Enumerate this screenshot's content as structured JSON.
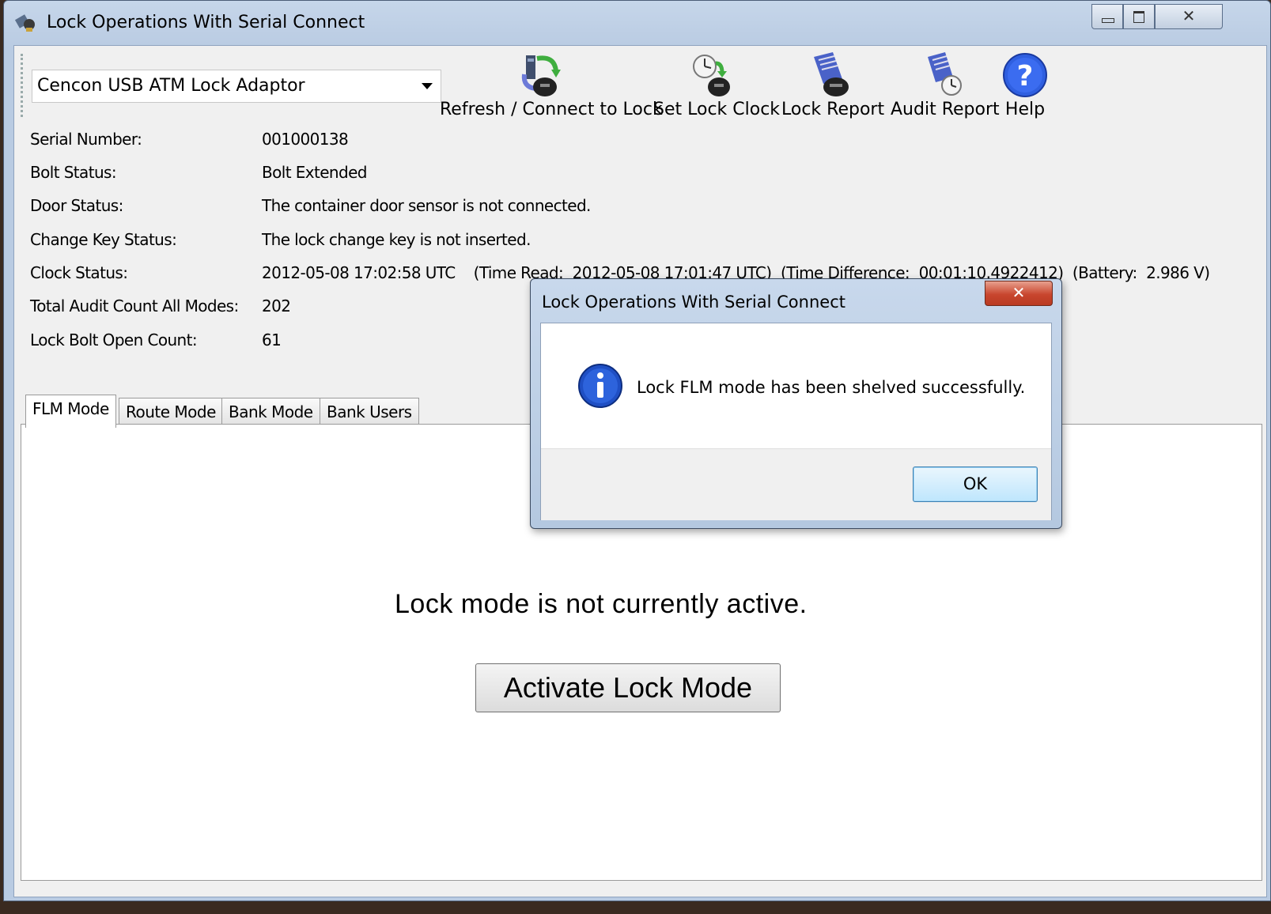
{
  "window": {
    "title": "Lock Operations With Serial Connect",
    "icon": "lock-app-icon"
  },
  "toolbar": {
    "device_select_value": "Cencon USB ATM Lock Adaptor",
    "buttons": [
      {
        "label": "Refresh / Connect to Lock",
        "icon": "refresh-connect-icon"
      },
      {
        "label": "Set Lock Clock",
        "icon": "clock-icon"
      },
      {
        "label": "Lock Report",
        "icon": "lock-report-icon"
      },
      {
        "label": "Audit Report",
        "icon": "audit-report-icon"
      },
      {
        "label": "Help",
        "icon": "help-icon"
      }
    ]
  },
  "info": {
    "serial_label": "Serial Number:",
    "serial_value": "001000138",
    "bolt_label": "Bolt Status:",
    "bolt_value": "Bolt Extended",
    "door_label": "Door Status:",
    "door_value": "The container door sensor is not connected.",
    "changekey_label": "Change Key Status:",
    "changekey_value": "The lock change key is not inserted.",
    "clock_label": "Clock Status:",
    "clock_value": "2012-05-08 17:02:58 UTC    (Time Read:  2012-05-08 17:01:47 UTC)  (Time Difference:  00:01:10.4922412)  (Battery:  2.986 V)",
    "audit_label": "Total Audit Count All Modes:",
    "audit_value": "202",
    "bolt_open_label": "Lock Bolt Open Count:",
    "bolt_open_value": "61"
  },
  "tabs": [
    {
      "label": "FLM Mode",
      "active": true
    },
    {
      "label": "Route Mode",
      "active": false
    },
    {
      "label": "Bank Mode",
      "active": false
    },
    {
      "label": "Bank Users",
      "active": false
    }
  ],
  "panel": {
    "status_message": "Lock mode is not currently active.",
    "activate_button": "Activate Lock Mode"
  },
  "dialog": {
    "title": "Lock Operations With Serial Connect",
    "message": "Lock FLM mode has been shelved successfully.",
    "ok_label": "OK",
    "icon": "information-icon"
  },
  "colors": {
    "title_bar": "#b9cbe2",
    "client_bg": "#f0f0f0",
    "close_button": "#c8462e",
    "ok_button": "#bee6fd"
  }
}
